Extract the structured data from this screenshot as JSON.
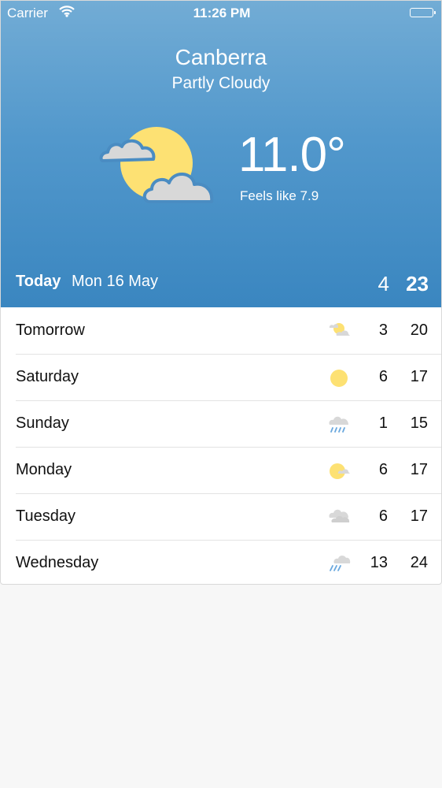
{
  "status_bar": {
    "carrier": "Carrier",
    "time": "11:26 PM"
  },
  "location": {
    "city": "Canberra",
    "condition": "Partly Cloudy"
  },
  "current": {
    "temperature": "11.0°",
    "feels_like": "Feels like 7.9",
    "icon": "partly-cloudy-icon"
  },
  "today": {
    "label": "Today",
    "date": "Mon 16 May",
    "low": "4",
    "high": "23"
  },
  "forecast": [
    {
      "day": "Tomorrow",
      "icon": "partly-cloudy-icon",
      "low": "3",
      "high": "20"
    },
    {
      "day": "Saturday",
      "icon": "sun-icon",
      "low": "6",
      "high": "17"
    },
    {
      "day": "Sunday",
      "icon": "rain-icon",
      "low": "1",
      "high": "15"
    },
    {
      "day": "Monday",
      "icon": "sun-cloud-icon",
      "low": "6",
      "high": "17"
    },
    {
      "day": "Tuesday",
      "icon": "cloudy-icon",
      "low": "6",
      "high": "17"
    },
    {
      "day": "Wednesday",
      "icon": "showers-icon",
      "low": "13",
      "high": "24"
    }
  ],
  "colors": {
    "hero_top": "#72acd5",
    "hero_bottom": "#3a86c0",
    "sun": "#fde173",
    "cloud": "#d8d8d8",
    "outline": "#4a8cc2",
    "rain": "#6aa8de"
  }
}
